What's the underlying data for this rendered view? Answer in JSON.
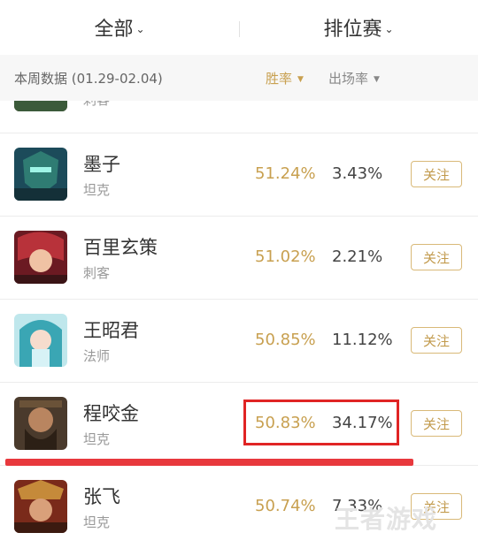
{
  "header": {
    "tabs": [
      {
        "label": "全部"
      },
      {
        "label": "排位赛"
      }
    ]
  },
  "filter": {
    "week_label": "本周数据 (01.29-02.04)",
    "sort_winrate": "胜率",
    "sort_pickrate": "出场率"
  },
  "partial_role": "刺客",
  "heroes": [
    {
      "name": "墨子",
      "role": "坦克",
      "win_rate": "51.24%",
      "pick_rate": "3.43%",
      "follow": "关注"
    },
    {
      "name": "百里玄策",
      "role": "刺客",
      "win_rate": "51.02%",
      "pick_rate": "2.21%",
      "follow": "关注"
    },
    {
      "name": "王昭君",
      "role": "法师",
      "win_rate": "50.85%",
      "pick_rate": "11.12%",
      "follow": "关注"
    },
    {
      "name": "程咬金",
      "role": "坦克",
      "win_rate": "50.83%",
      "pick_rate": "34.17%",
      "follow": "关注"
    },
    {
      "name": "张飞",
      "role": "坦克",
      "win_rate": "50.74%",
      "pick_rate": "7.33%",
      "follow": "关注"
    }
  ],
  "watermark": "王者游戏",
  "colors": {
    "accent_gold": "#c8a050",
    "highlight_red": "#e02424",
    "underline_red": "#e8383d"
  }
}
